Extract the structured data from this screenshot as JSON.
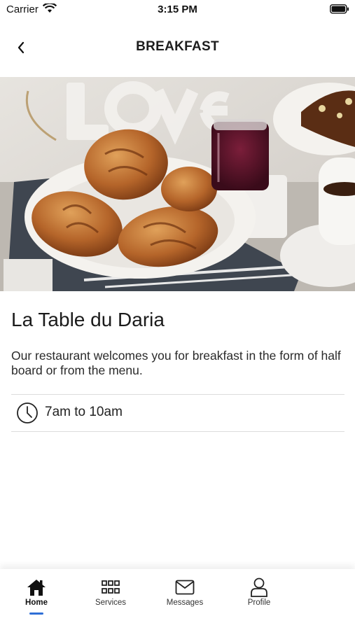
{
  "status_bar": {
    "carrier": "Carrier",
    "time": "3:15 PM"
  },
  "nav": {
    "title": "BREAKFAST",
    "back_icon": "chevron-left-icon"
  },
  "hero": {
    "logo_text": "Love"
  },
  "content": {
    "title": "La Table du Daria",
    "description": "Our restaurant welcomes you for breakfast in the form of half board or from the menu.",
    "hours": "7am to 10am",
    "hours_icon": "clock-icon"
  },
  "tabs": [
    {
      "label": "Home",
      "icon": "home-icon",
      "active": true
    },
    {
      "label": "Services",
      "icon": "grid-icon",
      "active": false
    },
    {
      "label": "Messages",
      "icon": "mail-icon",
      "active": false
    },
    {
      "label": "Profile",
      "icon": "user-icon",
      "active": false
    }
  ],
  "colors": {
    "accent": "#2f6fd6",
    "text": "#1c1c1c",
    "divider": "#dcdcdc"
  }
}
